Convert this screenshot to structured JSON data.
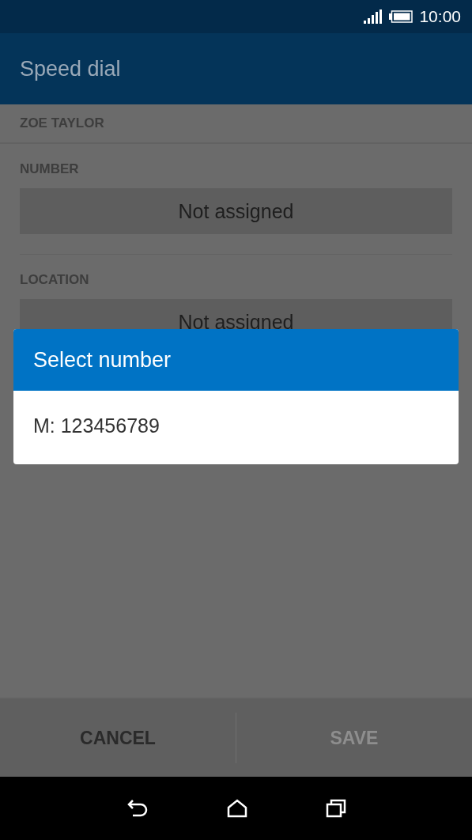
{
  "status_bar": {
    "time": "10:00"
  },
  "app_bar": {
    "title": "Speed dial"
  },
  "contact": {
    "name": "ZOE TAYLOR"
  },
  "fields": [
    {
      "label": "NUMBER",
      "value": "Not assigned"
    },
    {
      "label": "LOCATION",
      "value": "Not assigned"
    }
  ],
  "dialog": {
    "title": "Select number",
    "options": [
      "M: 123456789"
    ]
  },
  "actions": [
    {
      "label": "CANCEL",
      "disabled": false
    },
    {
      "label": "SAVE",
      "disabled": true
    }
  ]
}
